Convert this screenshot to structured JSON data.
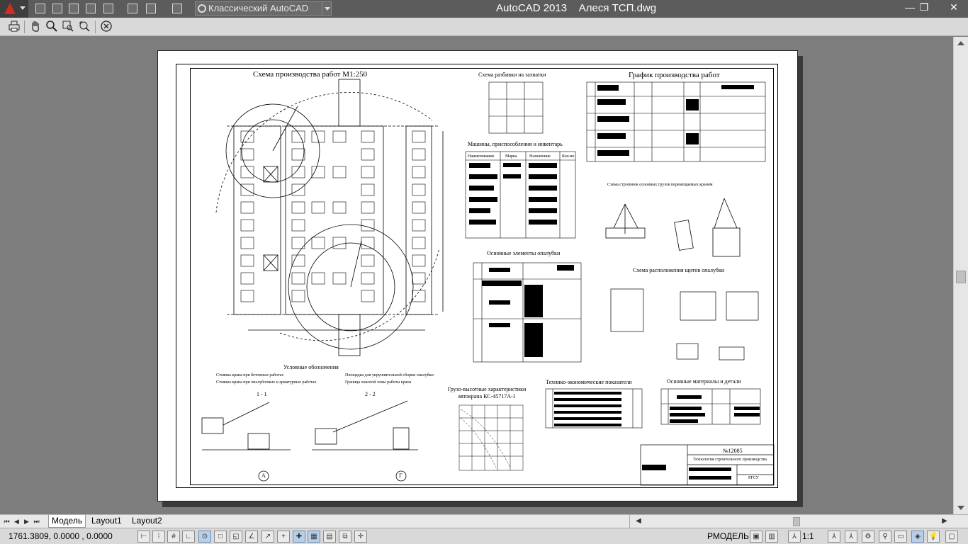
{
  "titlebar": {
    "window_title": "AutoCAD 2013    Алеся ТСП.dwg",
    "workspace": "Классический AutoCAD",
    "minimize": "—",
    "restore": "❐",
    "close": "✕"
  },
  "drawing": {
    "title_main": "Схема производства работ М1:250",
    "title_capture": "Схема разбивки на захватки",
    "title_schedule": "График производства работ",
    "title_machines": "Машины, приспособления и инвентарь",
    "machines_headers": [
      "Наименование",
      "Марка",
      "Назначение",
      "Кол-во"
    ],
    "title_formwork": "Основные элементы опалубки",
    "title_slinging": "Схема строповок основных грузов перемещаемых краном",
    "title_panels": "Схема расположения щитов опалубки",
    "legend_title": "Условные обозначения",
    "legend_items": [
      "Стоянка крана при бетонных работах",
      "Стоянка крана при опалубочных и арматурных работах",
      "Площадка для укрупнительной сборки опалубки",
      "Граница опасной зоны работы крана"
    ],
    "section_1": "1 - 1",
    "section_2": "2 - 2",
    "axis_a": "А",
    "axis_g": "Г",
    "title_crane_chart": "Грузо-высотные характеристики автокрана КС-45717А-1",
    "title_economics": "Технико-экономические показатели",
    "title_materials": "Основные материалы и детали",
    "stamp_code": "№12085",
    "stamp_subject": "Технология строительного производства",
    "stamp_org": "РГСУ"
  },
  "tabs": {
    "model": "Модель",
    "layout1": "Layout1",
    "layout2": "Layout2"
  },
  "status": {
    "coords": "1761.3809, 0.0000 , 0.0000",
    "space": "РМОДЕЛЬ",
    "scale": "1:1"
  }
}
